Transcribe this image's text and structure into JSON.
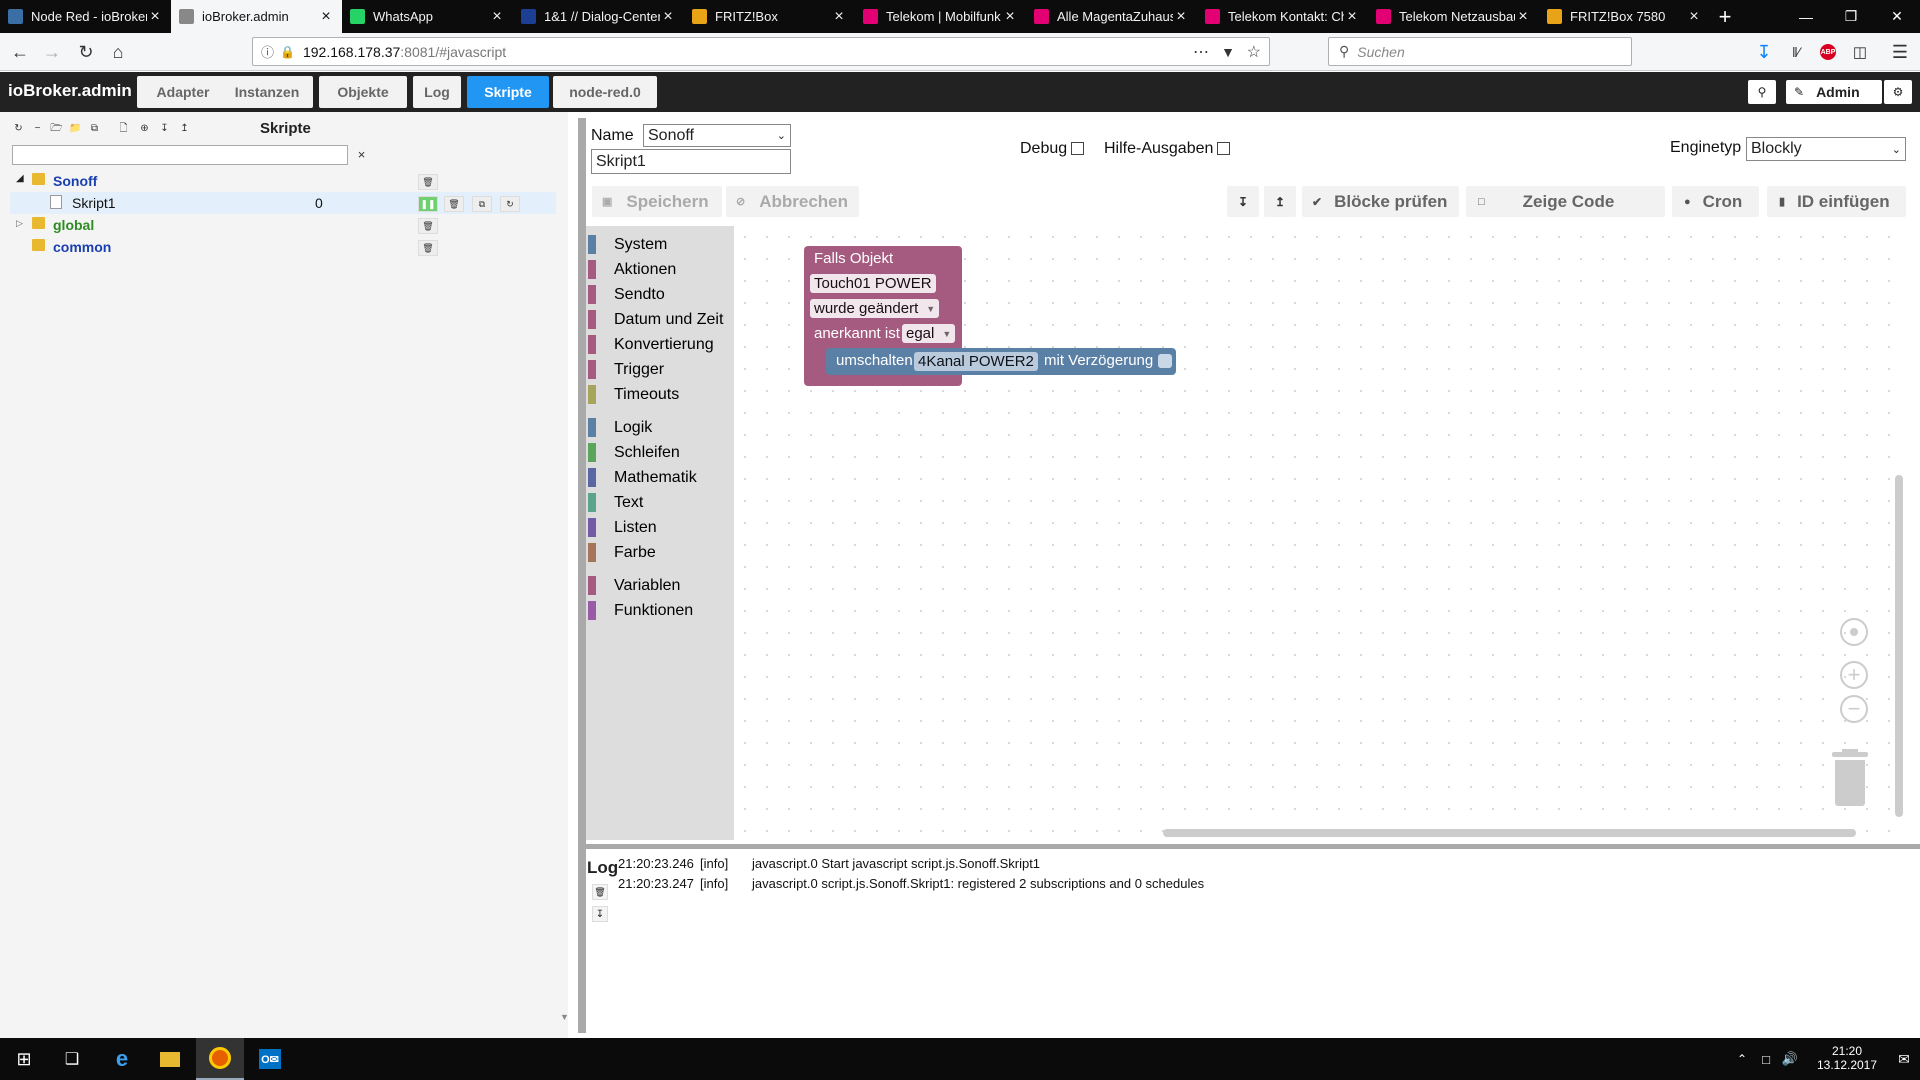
{
  "browser": {
    "tabs": [
      {
        "label": "Node Red - ioBroker",
        "icon_color": "#3b6ea5",
        "icon": "iobroker-icon"
      },
      {
        "label": "ioBroker.admin",
        "icon_color": "#888888",
        "icon": "gear-icon"
      },
      {
        "label": "WhatsApp",
        "icon_color": "#25d366",
        "icon": "whatsapp-icon"
      },
      {
        "label": "1&1 // Dialog-Center",
        "icon_color": "#1c3f94",
        "icon": "ionos-icon"
      },
      {
        "label": "FRITZ!Box",
        "icon_color": "#e8a317",
        "icon": "fritz-icon"
      },
      {
        "label": "Telekom | Mobilfunk",
        "icon_color": "#e20074",
        "icon": "telekom-icon"
      },
      {
        "label": "Alle MagentaZuhaus",
        "icon_color": "#e20074",
        "icon": "telekom-icon"
      },
      {
        "label": "Telekom Kontakt: Ch",
        "icon_color": "#e20074",
        "icon": "telekom-icon"
      },
      {
        "label": "Telekom Netzausbau",
        "icon_color": "#e20074",
        "icon": "telekom-icon"
      },
      {
        "label": "FRITZ!Box 7580",
        "icon_color": "#e8a317",
        "icon": "fritz-icon"
      }
    ],
    "url_host": "192.168.178.37",
    "url_rest": ":8081/#javascript",
    "search_placeholder": "Suchen"
  },
  "app": {
    "title": "ioBroker.admin",
    "tabs": [
      "Adapter",
      "Instanzen",
      "Objekte",
      "Log",
      "Skripte",
      "node-red.0"
    ],
    "active_tab": "Skripte",
    "user": "Admin",
    "accent": "#2196f3"
  },
  "tree": {
    "title": "Skripte",
    "rows": [
      {
        "name": "Sonoff",
        "type": "folder",
        "color": "#1a3fae"
      },
      {
        "name": "Skript1",
        "type": "script",
        "value": "0"
      },
      {
        "name": "global",
        "type": "folder",
        "color": "#2e8b22"
      },
      {
        "name": "common",
        "type": "folder",
        "color": "#1a3fae"
      }
    ]
  },
  "editor": {
    "name_label": "Name",
    "name_value": "Sonoff",
    "script_name": "Skript1",
    "debug_label": "Debug",
    "hilfe_label": "Hilfe-Ausgaben",
    "engine_label": "Enginetyp",
    "engine_value": "Blockly",
    "buttons": {
      "save": "Speichern",
      "cancel": "Abbrechen",
      "check": "Blöcke prüfen",
      "show_code": "Zeige Code",
      "cron": "Cron",
      "insert_id": "ID einfügen"
    }
  },
  "blockly": {
    "categories": [
      {
        "label": "System",
        "color": "#5b80a5"
      },
      {
        "label": "Aktionen",
        "color": "#a55b80"
      },
      {
        "label": "Sendto",
        "color": "#a55b80"
      },
      {
        "label": "Datum und Zeit",
        "color": "#a55b80"
      },
      {
        "label": "Konvertierung",
        "color": "#a55b80"
      },
      {
        "label": "Trigger",
        "color": "#a55b80"
      },
      {
        "label": "Timeouts",
        "color": "#a5a55b"
      },
      {
        "label": "Logik",
        "color": "#5b80a5"
      },
      {
        "label": "Schleifen",
        "color": "#5ba55b"
      },
      {
        "label": "Mathematik",
        "color": "#5b67a5"
      },
      {
        "label": "Text",
        "color": "#5ba58c"
      },
      {
        "label": "Listen",
        "color": "#745ba5"
      },
      {
        "label": "Farbe",
        "color": "#a5745b"
      },
      {
        "label": "Variablen",
        "color": "#a55b80"
      },
      {
        "label": "Funktionen",
        "color": "#995ba5"
      }
    ],
    "trigger_block": {
      "title": "Falls Objekt",
      "object": "Touch01 POWER",
      "condition": "wurde geändert",
      "ack_label": "anerkannt ist",
      "ack_value": "egal"
    },
    "action_block": {
      "label": "umschalten",
      "object": "4Kanal POWER2",
      "delay_label": "mit Verzögerung"
    }
  },
  "log": {
    "label": "Log",
    "entries": [
      {
        "time": "21:20:23.246",
        "level": "[info]",
        "msg": "javascript.0 Start javascript script.js.Sonoff.Skript1"
      },
      {
        "time": "21:20:23.247",
        "level": "[info]",
        "msg": "javascript.0 script.js.Sonoff.Skript1: registered 2 subscriptions and 0 schedules"
      }
    ]
  },
  "taskbar": {
    "time": "21:20",
    "date": "13.12.2017"
  }
}
